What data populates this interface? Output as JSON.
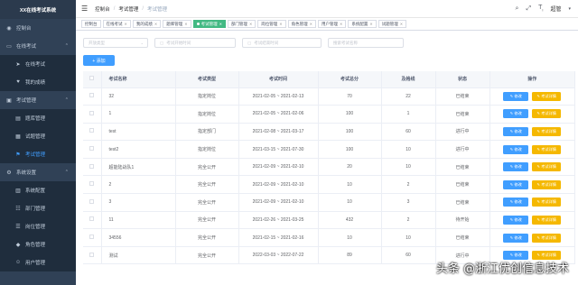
{
  "app": {
    "title": "XX在线考试系统"
  },
  "sidebar": {
    "items": [
      {
        "label": "控制台",
        "icon": "dashboard-icon"
      },
      {
        "label": "在线考试",
        "icon": "monitor-icon"
      },
      {
        "label": "在线考试",
        "icon": "send-icon"
      },
      {
        "label": "我的成绩",
        "icon": "score-icon"
      },
      {
        "label": "考试管理",
        "icon": "exam-icon"
      },
      {
        "label": "题库管理",
        "icon": "book-icon"
      },
      {
        "label": "试题管理",
        "icon": "question-icon"
      },
      {
        "label": "考试管理",
        "icon": "flag-icon"
      },
      {
        "label": "系统设置",
        "icon": "settings-icon"
      },
      {
        "label": "系统配置",
        "icon": "config-icon"
      },
      {
        "label": "部门管理",
        "icon": "dept-icon"
      },
      {
        "label": "岗位管理",
        "icon": "post-icon"
      },
      {
        "label": "角色管理",
        "icon": "role-icon"
      },
      {
        "label": "用户管理",
        "icon": "user-icon"
      }
    ]
  },
  "header": {
    "breadcrumb": [
      "控制台",
      "考试管理",
      "考试管理"
    ],
    "user": "超管"
  },
  "tags": [
    {
      "label": "控制台"
    },
    {
      "label": "在线考试"
    },
    {
      "label": "我的成绩"
    },
    {
      "label": "题库管理"
    },
    {
      "label": "考试管理"
    },
    {
      "label": "部门管理"
    },
    {
      "label": "岗位管理"
    },
    {
      "label": "角色管理"
    },
    {
      "label": "用户管理"
    },
    {
      "label": "系统配置"
    },
    {
      "label": "试题管理"
    }
  ],
  "filters": {
    "type_placeholder": "开放类型",
    "start_placeholder": "考试开始时间",
    "end_placeholder": "考试结束时间",
    "name_placeholder": "搜索考试名称",
    "add_label": "+ 添加"
  },
  "table": {
    "headers": [
      "考试名称",
      "考试类型",
      "考试时间",
      "考试总分",
      "及格线",
      "状态",
      "操作"
    ],
    "edit_label": "✎ 修改",
    "detail_label": "✎ 考试详情",
    "rows": [
      {
        "name": "32",
        "type": "指定岗位",
        "time": "2021-02-05 ~ 2021-02-13",
        "total": "70",
        "pass": "22",
        "status": "已结束"
      },
      {
        "name": "1",
        "type": "指定岗位",
        "time": "2021-02-05 ~ 2021-02-06",
        "total": "100",
        "pass": "1",
        "status": "已结束"
      },
      {
        "name": "test",
        "type": "指定部门",
        "time": "2021-02-08 ~ 2021-03-17",
        "total": "100",
        "pass": "60",
        "status": "进行中"
      },
      {
        "name": "test2",
        "type": "指定岗位",
        "time": "2021-03-15 ~ 2021-07-30",
        "total": "100",
        "pass": "10",
        "status": "进行中"
      },
      {
        "name": "超能陆战队1",
        "type": "完全公开",
        "time": "2021-02-09 ~ 2021-02-10",
        "total": "20",
        "pass": "10",
        "status": "已结束"
      },
      {
        "name": "2",
        "type": "完全公开",
        "time": "2021-02-09 ~ 2021-02-10",
        "total": "10",
        "pass": "2",
        "status": "已结束"
      },
      {
        "name": "3",
        "type": "完全公开",
        "time": "2021-02-09 ~ 2021-02-10",
        "total": "10",
        "pass": "3",
        "status": "已结束"
      },
      {
        "name": "11",
        "type": "完全公开",
        "time": "2021-02-26 ~ 2021-03-25",
        "total": "432",
        "pass": "2",
        "status": "待开始"
      },
      {
        "name": "34556",
        "type": "完全公开",
        "time": "2021-02-15 ~ 2021-02-16",
        "total": "10",
        "pass": "10",
        "status": "已结束"
      },
      {
        "name": "测试",
        "type": "完全公开",
        "time": "2022-03-03 ~ 2022-07-22",
        "total": "89",
        "pass": "60",
        "status": "进行中"
      }
    ]
  },
  "watermark": "头条 @浙江优创信息技术"
}
